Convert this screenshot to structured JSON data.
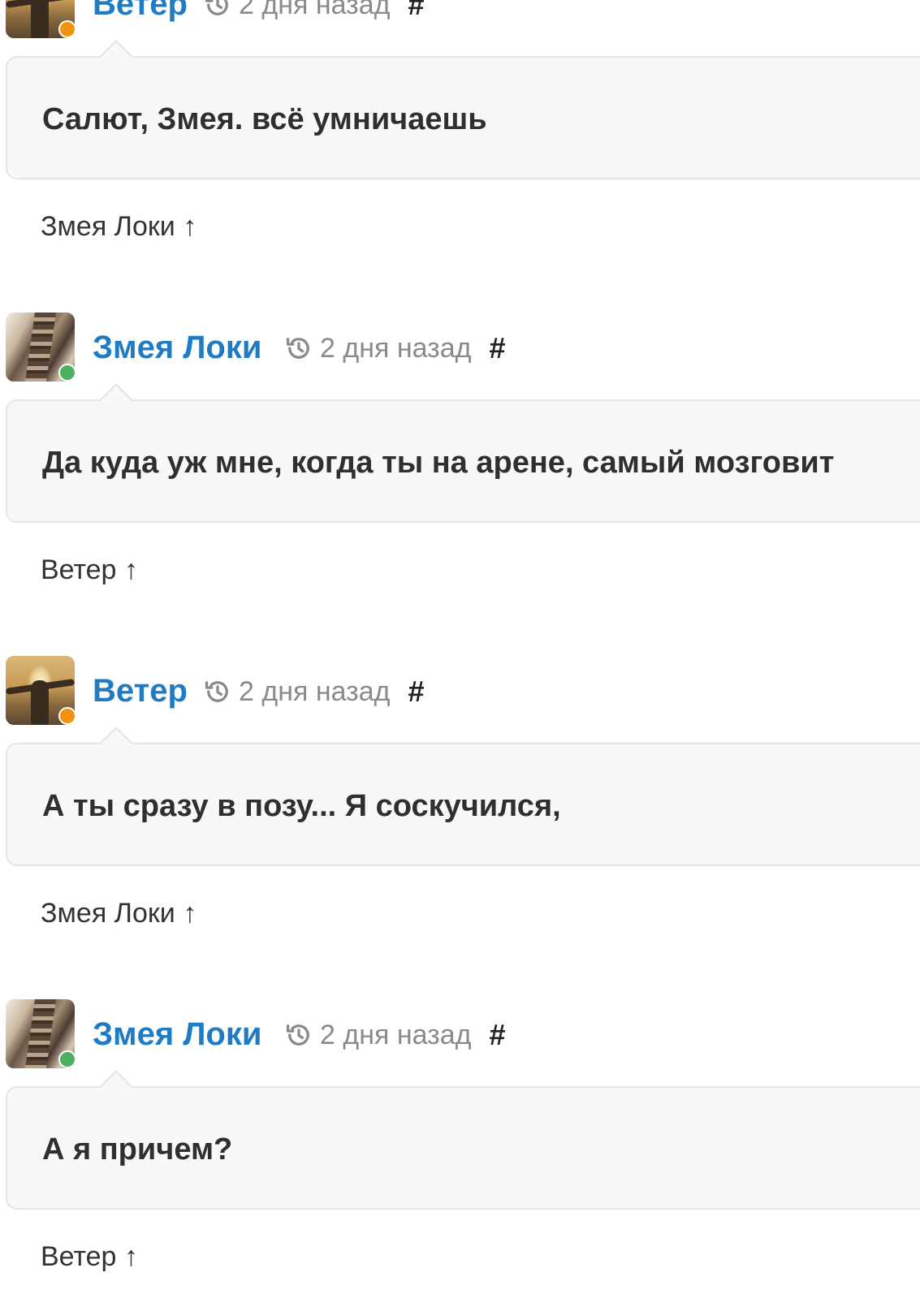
{
  "colors": {
    "author_link": "#1e7bc4",
    "status_away": "#f0920f",
    "status_online": "#4caf62",
    "bubble_bg": "#f7f8fa",
    "bubble_border": "#e3e5e8",
    "time_text": "#8a8a8a"
  },
  "comments": [
    {
      "author": "Ветер",
      "avatar": "wind-avatar",
      "status": "away",
      "time_icon": "history-icon",
      "time": "2 дня назад",
      "permalink": "#",
      "text": "Салют, Змея. всё умничаешь",
      "reply_to": "Змея Локи ↑"
    },
    {
      "author": "Змея Локи",
      "avatar": "snake-avatar",
      "status": "online",
      "time_icon": "history-icon",
      "time": "2 дня назад",
      "permalink": "#",
      "text": "Да куда уж мне, когда ты на арене, самый мозговит",
      "reply_to": "Ветер ↑"
    },
    {
      "author": "Ветер",
      "avatar": "wind-avatar",
      "status": "away",
      "time_icon": "history-icon",
      "time": "2 дня назад",
      "permalink": "#",
      "text": "А ты сразу в позу... Я соскучился,",
      "reply_to": "Змея Локи ↑"
    },
    {
      "author": "Змея Локи",
      "avatar": "snake-avatar",
      "status": "online",
      "time_icon": "history-icon",
      "time": "2 дня назад",
      "permalink": "#",
      "text": "А я причем?",
      "reply_to": "Ветер ↑"
    }
  ]
}
